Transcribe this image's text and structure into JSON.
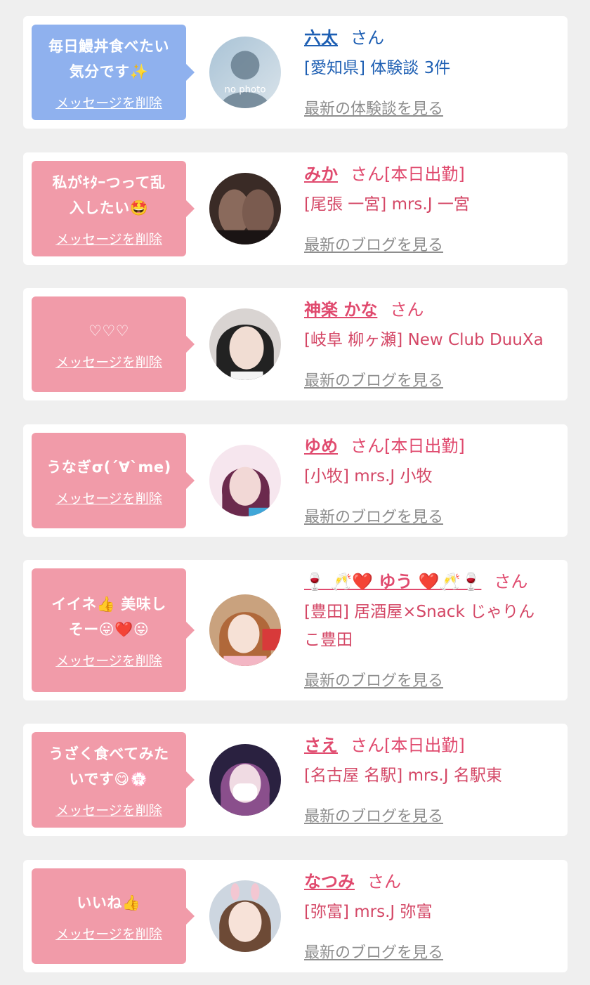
{
  "delete_label": "メッセージを削除",
  "colors": {
    "blue_bubble": "#8fb1ee",
    "pink_bubble": "#f19ba9",
    "blue_text": "#1e5fb3",
    "pink_text": "#e04a6e"
  },
  "cards": [
    {
      "message": [
        "毎日鰻丼食べたい",
        "気分です✨"
      ],
      "name": "六太",
      "suffix": "さん",
      "shop": "[愛知県] 体験談 3件",
      "link": "最新の体験談を見る",
      "avatar_text": "no photo"
    },
    {
      "message": [
        "私がｷﾀｰつって乱",
        "入したい🤩"
      ],
      "name": "みか",
      "suffix": "さん[本日出勤]",
      "shop": "[尾張 一宮] mrs.J 一宮",
      "link": "最新のブログを見る"
    },
    {
      "message": [
        "♡♡♡"
      ],
      "name": "神楽 かな",
      "suffix": "さん",
      "shop": "[岐阜 柳ヶ瀬] New Club DuuXa",
      "link": "最新のブログを見る"
    },
    {
      "message": [
        "うなぎσ(´∀`me)"
      ],
      "name": "ゆめ",
      "suffix": "さん[本日出勤]",
      "shop": "[小牧] mrs.J 小牧",
      "link": "最新のブログを見る"
    },
    {
      "message": [
        "イイネ👍 美味し",
        "そー😛❤️😛"
      ],
      "name": "🍷 🥂❤️ ゆう ❤️🥂🍷",
      "suffix": "さん",
      "shop": [
        "[豊田] 居酒屋×Snack じゃりん",
        "こ豊田"
      ],
      "link": "最新のブログを見る"
    },
    {
      "message": [
        "うざく食べてみた",
        "いです😋💮"
      ],
      "name": "さえ",
      "suffix": "さん[本日出勤]",
      "shop": "[名古屋 名駅] mrs.J 名駅東",
      "link": "最新のブログを見る"
    },
    {
      "message": [
        "いいね👍"
      ],
      "name": "なつみ",
      "suffix": "さん",
      "shop": "[弥富] mrs.J 弥富",
      "link": "最新のブログを見る"
    }
  ]
}
